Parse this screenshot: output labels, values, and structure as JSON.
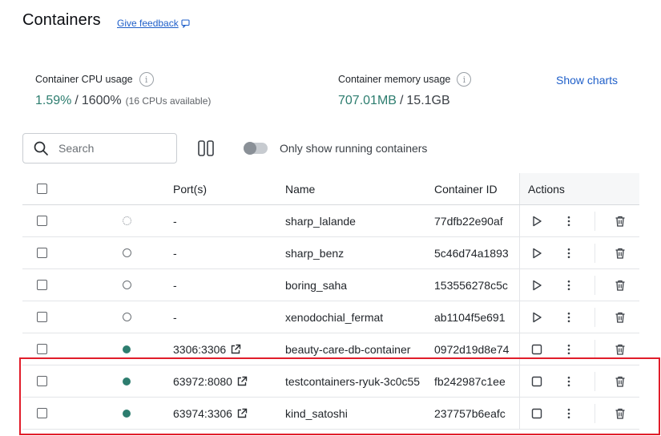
{
  "header": {
    "title": "Containers",
    "feedback_label": "Give feedback"
  },
  "stats": {
    "cpu": {
      "label": "Container CPU usage",
      "used": "1.59%",
      "separator": " / ",
      "total": "1600%",
      "note": "(16 CPUs available)"
    },
    "memory": {
      "label": "Container memory usage",
      "used": "707.01MB",
      "separator": " / ",
      "total": "15.1GB"
    },
    "show_charts_label": "Show charts"
  },
  "toolbar": {
    "search_placeholder": "Search",
    "running_toggle_label": "Only show running containers",
    "running_toggle_on": false
  },
  "table": {
    "columns": {
      "ports": "Port(s)",
      "name": "Name",
      "container_id": "Container ID",
      "actions": "Actions"
    },
    "rows": [
      {
        "status": "created",
        "ports": "-",
        "name": "sharp_lalande",
        "container_id": "77dfb22e90af",
        "primary_action": "start-icon"
      },
      {
        "status": "stopped",
        "ports": "-",
        "name": "sharp_benz",
        "container_id": "5c46d74a1893",
        "primary_action": "start-icon"
      },
      {
        "status": "stopped",
        "ports": "-",
        "name": "boring_saha",
        "container_id": "153556278c5c",
        "primary_action": "start-icon"
      },
      {
        "status": "stopped",
        "ports": "-",
        "name": "xenodochial_fermat",
        "container_id": "ab1104f5e691",
        "primary_action": "start-icon"
      },
      {
        "status": "running",
        "ports": "3306:3306",
        "name": "beauty-care-db-container",
        "container_id": "0972d19d8e74",
        "primary_action": "stop-icon"
      },
      {
        "status": "running",
        "ports": "63972:8080",
        "name": "testcontainers-ryuk-3c0c55",
        "container_id": "fb242987c1ee",
        "primary_action": "stop-icon"
      },
      {
        "status": "running",
        "ports": "63974:3306",
        "name": "kind_satoshi",
        "container_id": "237757b6eafc",
        "primary_action": "stop-icon"
      }
    ]
  },
  "colors": {
    "accent_link": "#1f5fc9",
    "running_green": "#2d7d6f",
    "highlight_red": "#e11d2a"
  }
}
